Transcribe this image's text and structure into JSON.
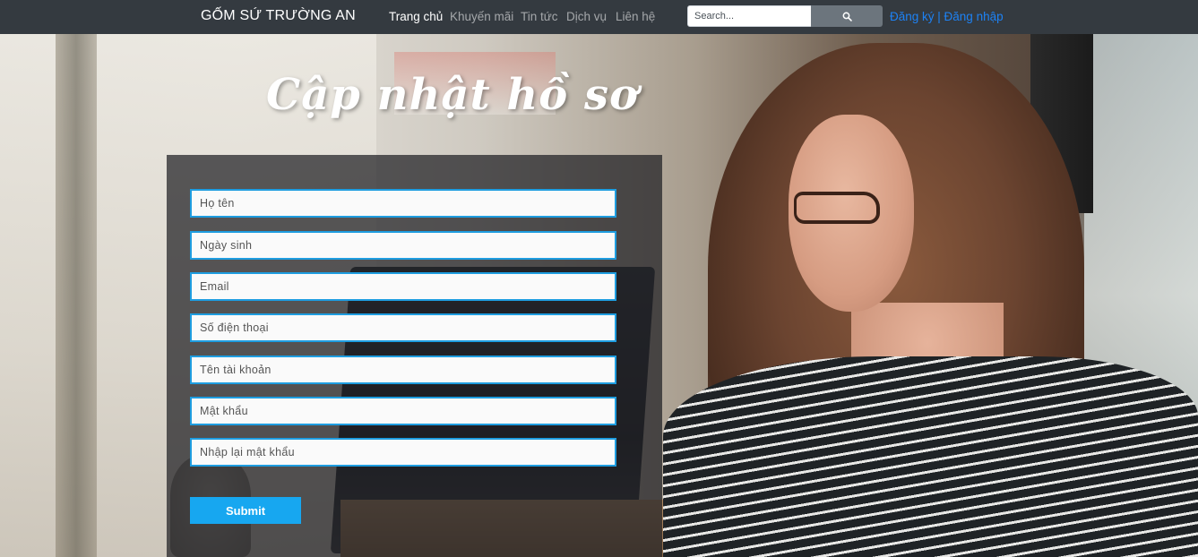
{
  "navbar": {
    "brand": "GỐM SỨ TRƯỜNG AN",
    "links": [
      "Trang chủ",
      "Khuyến mãi",
      "Tin tức",
      "Dịch vụ",
      "Liên hệ"
    ],
    "active_index": 0,
    "search": {
      "placeholder": "Search...",
      "icon": "search-icon"
    },
    "auth": {
      "register": "Đăng ký",
      "separator": " | ",
      "login": "Đăng nhập"
    }
  },
  "hero": {
    "title": "Cập nhật hồ sơ"
  },
  "form": {
    "fields": [
      {
        "placeholder": "Họ tên"
      },
      {
        "placeholder": "Ngày sinh"
      },
      {
        "placeholder": "Email"
      },
      {
        "placeholder": "Số điện thoại"
      },
      {
        "placeholder": "Tên tài khoản"
      },
      {
        "placeholder": "Mật khẩu"
      },
      {
        "placeholder": "Nhập lại mật khẩu"
      }
    ],
    "submit_label": "Submit"
  },
  "colors": {
    "navbar_bg": "#343a40",
    "link_accent": "#1d82f5",
    "field_border": "#1e9de0",
    "submit_bg": "#17a7f0"
  }
}
